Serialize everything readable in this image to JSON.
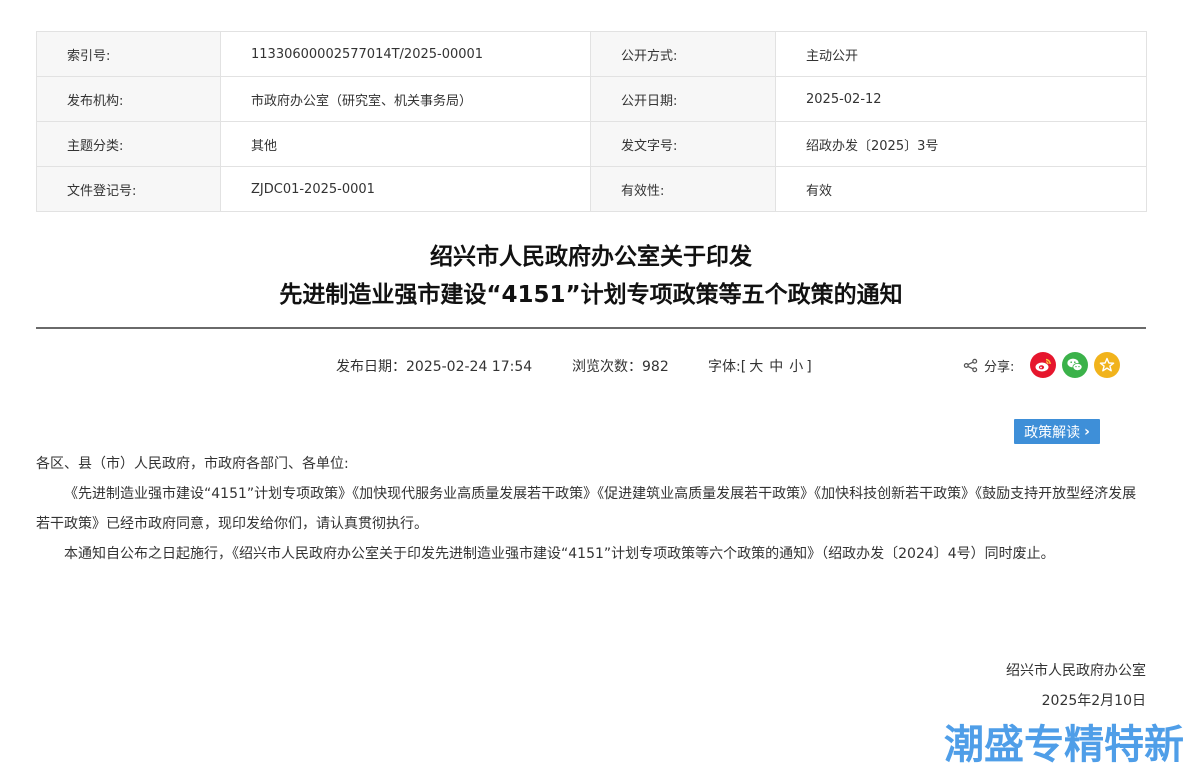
{
  "meta": {
    "rows": [
      {
        "l1": "索引号:",
        "v1": "11330600002577014T/2025-00001",
        "l2": "公开方式:",
        "v2": "主动公开"
      },
      {
        "l1": "发布机构:",
        "v1": "市政府办公室（研究室、机关事务局）",
        "l2": "公开日期:",
        "v2": "2025-02-12"
      },
      {
        "l1": "主题分类:",
        "v1": "其他",
        "l2": "发文字号:",
        "v2": "绍政办发〔2025〕3号"
      },
      {
        "l1": "文件登记号:",
        "v1": "ZJDC01-2025-0001",
        "l2": "有效性:",
        "v2": "有效"
      }
    ]
  },
  "title": {
    "line1": "绍兴市人民政府办公室关于印发",
    "line2": "先进制造业强市建设“4151”计划专项政策等五个政策的通知"
  },
  "info": {
    "publish": "发布日期：2025-02-24 17:54",
    "views": "浏览次数：982",
    "font_label": "字体:[",
    "font_large": "大",
    "font_medium": "中",
    "font_small": "小",
    "font_end": "]",
    "share_label": "分享:"
  },
  "policy_button": "政策解读",
  "body": {
    "greeting": "各区、县（市）人民政府，市政府各部门、各单位:",
    "para1": "《先进制造业强市建设“4151”计划专项政策》《加快现代服务业高质量发展若干政策》《促进建筑业高质量发展若干政策》《加快科技创新若干政策》《鼓励支持开放型经济发展若干政策》已经市政府同意，现印发给你们，请认真贯彻执行。",
    "para2": "本通知自公布之日起施行，《绍兴市人民政府办公室关于印发先进制造业强市建设“4151”计划专项政策等六个政策的通知》（绍政办发〔2024〕4号）同时废止。"
  },
  "signature": {
    "org": "绍兴市人民政府办公室",
    "date": "2025年2月10日"
  },
  "watermark": "潮盛专精特新",
  "colors": {
    "accent": "#3e8fd8",
    "weibo": "#e6162d",
    "wechat": "#3bb24a",
    "favorite": "#f1b31c",
    "watermark": "#4f9ee8"
  }
}
